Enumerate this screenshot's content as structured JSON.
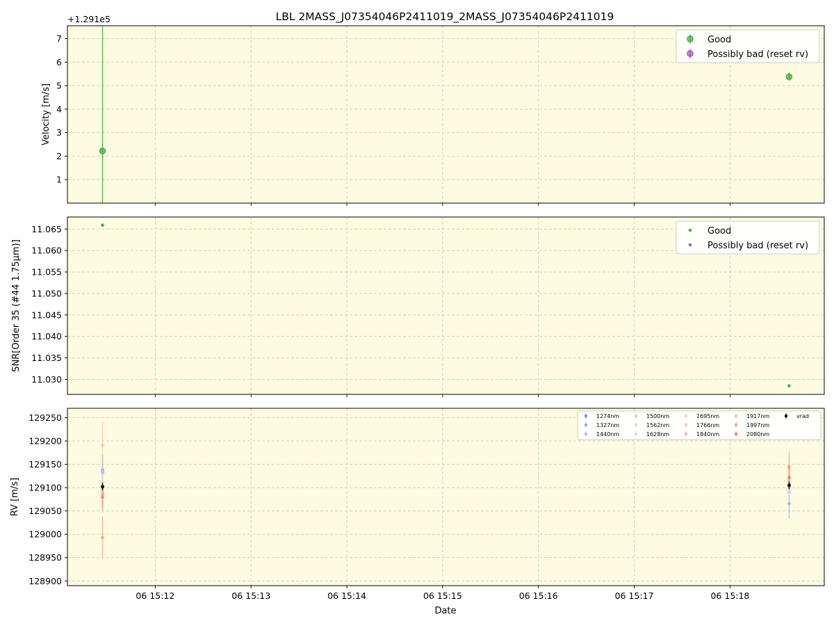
{
  "figure_title": "LBL 2MASS_J07354046P2411019_2MASS_J07354046P2411019",
  "x_axis_label": "Date",
  "x_tick_labels": [
    "06 15:12",
    "06 15:13",
    "06 15:14",
    "06 15:15",
    "06 15:16",
    "06 15:17",
    "06 15:18"
  ],
  "colors": {
    "panel_background": "#fdfbe0",
    "good": "#2ca02c",
    "bad": "#9b3fb0",
    "grid": "#cccccc",
    "vrad": "#000000"
  },
  "chart_data": [
    {
      "type": "scatter",
      "ylabel": "Velocity [m/s]",
      "y_offset_label": "+1.291e5",
      "x_range": [
        "15:11:05",
        "15:18:59"
      ],
      "ylim": [
        0.0,
        7.55
      ],
      "yticks": [
        1,
        2,
        3,
        4,
        5,
        6,
        7
      ],
      "y_tick_labels": [
        "1",
        "2",
        "3",
        "4",
        "5",
        "6",
        "7"
      ],
      "legend": {
        "position": "upper right",
        "entries": [
          "Good",
          "Possibly bad (reset rv)"
        ]
      },
      "series": [
        {
          "name": "Good",
          "x": [
            "15:11:27",
            "15:18:37"
          ],
          "y": [
            2.22,
            5.38
          ],
          "yerr": [
            10.0,
            0.18
          ]
        },
        {
          "name": "Possibly bad (reset rv)",
          "x": [],
          "y": [],
          "yerr": []
        }
      ]
    },
    {
      "type": "scatter",
      "ylabel": "SNR[Order 35 (#44 1.75μm)]",
      "x_range": [
        "15:11:05",
        "15:18:59"
      ],
      "ylim": [
        11.0265,
        11.0678
      ],
      "yticks": [
        11.03,
        11.035,
        11.04,
        11.045,
        11.05,
        11.055,
        11.06,
        11.065
      ],
      "y_tick_labels": [
        "11.030",
        "11.035",
        "11.040",
        "11.045",
        "11.050",
        "11.055",
        "11.060",
        "11.065"
      ],
      "legend": {
        "position": "upper right",
        "entries": [
          "Good",
          "Possibly bad (reset rv)"
        ]
      },
      "series": [
        {
          "name": "Good",
          "x": [
            "15:11:27",
            "15:18:37"
          ],
          "y": [
            11.0659,
            11.0285
          ]
        },
        {
          "name": "Possibly bad (reset rv)",
          "x": [],
          "y": []
        }
      ]
    },
    {
      "type": "scatter",
      "ylabel": "RV [m/s]",
      "x_range": [
        "15:11:05",
        "15:18:59"
      ],
      "ylim": [
        128890,
        129270
      ],
      "yticks": [
        128900,
        128950,
        129000,
        129050,
        129100,
        129150,
        129200,
        129250
      ],
      "y_tick_labels": [
        "128900",
        "128950",
        "129000",
        "129050",
        "129100",
        "129150",
        "129200",
        "129250"
      ],
      "legend": {
        "position": "upper right",
        "columns": 5
      },
      "series": [
        {
          "name": "1274nm",
          "color": "#6f93ee",
          "x": [
            "15:11:27",
            "15:18:37"
          ],
          "y": [
            129138,
            129100
          ],
          "yerr": [
            32,
            22
          ]
        },
        {
          "name": "1327nm",
          "color": "#8cadf6",
          "x": [
            "15:11:27",
            "15:18:37"
          ],
          "y": [
            129132,
            129066
          ],
          "yerr": [
            28,
            32
          ]
        },
        {
          "name": "1440nm",
          "color": "#a8c4f9",
          "x": [
            "15:11:27",
            "15:18:37"
          ],
          "y": [
            129135,
            129090
          ],
          "yerr": [
            25,
            28
          ]
        },
        {
          "name": "1500nm",
          "color": "#c0d3f5",
          "x": [
            "15:11:27",
            "15:18:37"
          ],
          "y": [
            129110,
            129092
          ],
          "yerr": [
            30,
            26
          ]
        },
        {
          "name": "1562nm",
          "color": "#d4dced",
          "x": [
            "15:11:27",
            "15:18:37"
          ],
          "y": [
            129100,
            129100
          ],
          "yerr": [
            28,
            22
          ]
        },
        {
          "name": "1628nm",
          "color": "#dddddd",
          "x": [
            "15:11:27",
            "15:18:37"
          ],
          "y": [
            129095,
            129105
          ],
          "yerr": [
            30,
            20
          ]
        },
        {
          "name": "1695nm",
          "color": "#e8d8cf",
          "x": [
            "15:11:27",
            "15:18:37"
          ],
          "y": [
            129090,
            129110
          ],
          "yerr": [
            32,
            22
          ]
        },
        {
          "name": "1766nm",
          "color": "#f2cbbf",
          "x": [
            "15:11:27",
            "15:18:37"
          ],
          "y": [
            129088,
            129115
          ],
          "yerr": [
            30,
            22
          ]
        },
        {
          "name": "1840nm",
          "color": "#f4bba8",
          "x": [
            "15:11:27",
            "15:18:37"
          ],
          "y": [
            129085,
            129120
          ],
          "yerr": [
            28,
            24
          ]
        },
        {
          "name": "1917nm",
          "color": "#f6c6a4",
          "x": [
            "15:11:27",
            "15:18:37"
          ],
          "y": [
            129191,
            129140
          ],
          "yerr": [
            52,
            30
          ]
        },
        {
          "name": "1997nm",
          "color": "#f2a885",
          "x": [
            "15:11:27",
            "15:18:37"
          ],
          "y": [
            128993,
            129145
          ],
          "yerr": [
            45,
            32
          ]
        },
        {
          "name": "2080nm",
          "color": "#e8866c",
          "x": [
            "15:11:27",
            "15:18:37"
          ],
          "y": [
            129080,
            129122
          ],
          "yerr": [
            30,
            26
          ]
        },
        {
          "name": "vrad",
          "color": "#000000",
          "x": [
            "15:11:27",
            "15:18:37"
          ],
          "y": [
            129102,
            129105
          ],
          "yerr": [
            8,
            8
          ]
        }
      ]
    }
  ]
}
